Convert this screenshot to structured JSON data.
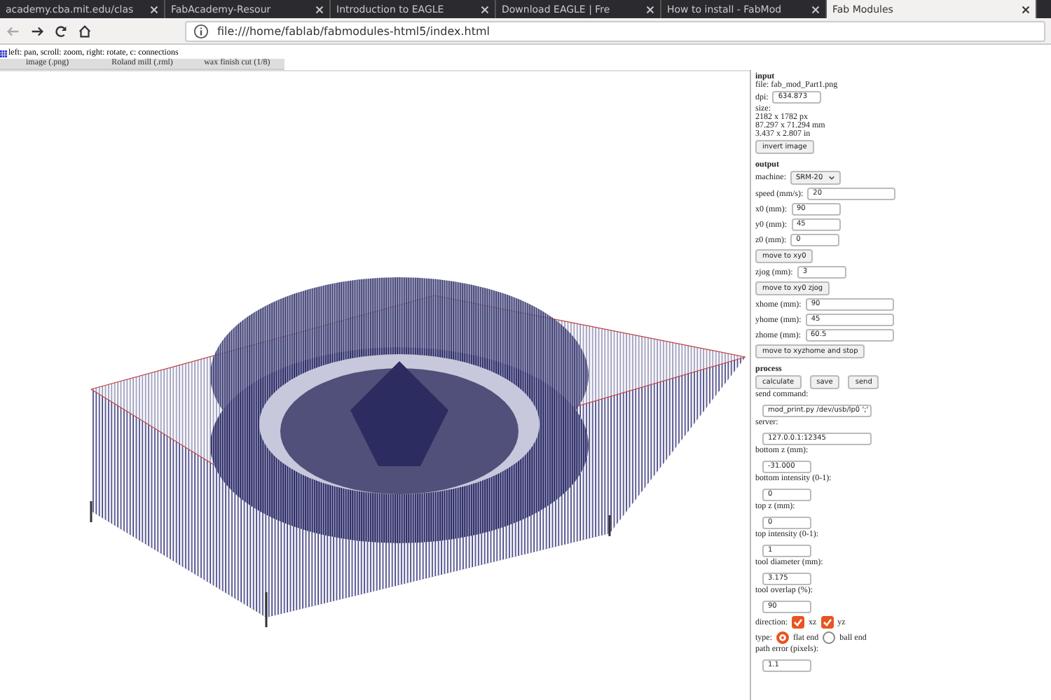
{
  "browser": {
    "tabs": [
      {
        "title": "academy.cba.mit.edu/clas",
        "selected": false
      },
      {
        "title": "FabAcademy-Resour",
        "selected": false
      },
      {
        "title": "Introduction to EAGLE",
        "selected": false
      },
      {
        "title": "Download EAGLE | Fre",
        "selected": false
      },
      {
        "title": "How to install - FabMod",
        "selected": false
      },
      {
        "title": "Fab Modules",
        "selected": true
      }
    ],
    "address": "file:///home/fablab/fabmodules-html5/index.html"
  },
  "page": {
    "hint": "left: pan, scroll: zoom, right: rotate, c: connections",
    "menus": [
      "image (.png)",
      "Roland mill (.rml)",
      "wax finish cut (1/8)"
    ],
    "panel": [
      {
        "kind": "heading",
        "text": "input"
      },
      {
        "kind": "text",
        "text": "file: fab_mod_Part1.png"
      },
      {
        "kind": "field",
        "label": "dpi:",
        "value": "634.873"
      },
      {
        "kind": "text",
        "text": "size:"
      },
      {
        "kind": "text",
        "text": "2182 x 1782 px"
      },
      {
        "kind": "text",
        "text": "87.297 x 71.294 mm"
      },
      {
        "kind": "text",
        "text": "3.437 x 2.807 in"
      },
      {
        "kind": "buttons",
        "buttons": [
          "invert image"
        ]
      },
      {
        "kind": "heading",
        "text": "output"
      },
      {
        "kind": "select",
        "label": "machine:",
        "value": "SRM-20"
      },
      {
        "kind": "field",
        "label": "speed (mm/s):",
        "value": "20"
      },
      {
        "kind": "field",
        "label": "x0 (mm):",
        "value": "90"
      },
      {
        "kind": "field",
        "label": "y0 (mm):",
        "value": "45"
      },
      {
        "kind": "field",
        "label": "z0 (mm):",
        "value": "0"
      },
      {
        "kind": "buttons",
        "buttons": [
          "move to xy0"
        ]
      },
      {
        "kind": "field",
        "label": "zjog (mm):",
        "value": "3"
      },
      {
        "kind": "buttons",
        "buttons": [
          "move to xy0 zjog"
        ]
      },
      {
        "kind": "field",
        "label": "xhome (mm):",
        "value": "90"
      },
      {
        "kind": "field",
        "label": "yhome (mm):",
        "value": "45"
      },
      {
        "kind": "field",
        "label": "zhome (mm):",
        "value": "60.5"
      },
      {
        "kind": "buttons",
        "buttons": [
          "move to xyzhome and stop"
        ]
      },
      {
        "kind": "heading",
        "text": "process"
      },
      {
        "kind": "buttons",
        "buttons": [
          "calculate",
          "save",
          "send"
        ]
      },
      {
        "kind": "wide",
        "label": "send command:",
        "value": "mod_print.py /dev/usb/lp0 ';'"
      },
      {
        "kind": "wide",
        "label": "server:",
        "value": "127.0.0.1:12345"
      },
      {
        "kind": "stacked",
        "label": "bottom z (mm):",
        "value": "-31.000"
      },
      {
        "kind": "stacked",
        "label": "bottom intensity (0-1):",
        "value": "0"
      },
      {
        "kind": "stacked",
        "label": "top z (mm):",
        "value": "0"
      },
      {
        "kind": "stacked",
        "label": "top intensity (0-1):",
        "value": "1"
      },
      {
        "kind": "stacked",
        "label": "tool diameter (mm):",
        "value": "3.175"
      },
      {
        "kind": "stacked",
        "label": "tool overlap (%):",
        "value": "90"
      },
      {
        "kind": "checks",
        "label": "direction:",
        "options": [
          {
            "label": "xz",
            "checked": true
          },
          {
            "label": "yz",
            "checked": true
          }
        ]
      },
      {
        "kind": "radios",
        "label": "type:",
        "options": [
          {
            "label": "flat end",
            "selected": true
          },
          {
            "label": "ball end",
            "selected": false
          }
        ]
      },
      {
        "kind": "stacked",
        "label": "path error (pixels):",
        "value": "1.1"
      }
    ]
  }
}
